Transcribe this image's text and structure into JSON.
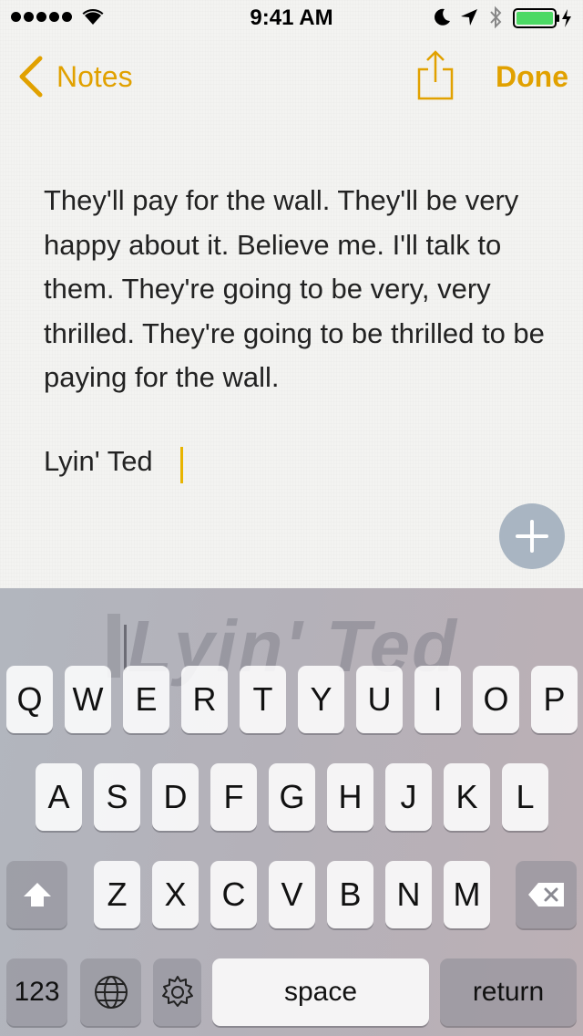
{
  "status_bar": {
    "time": "9:41 AM"
  },
  "nav": {
    "back_label": "Notes",
    "done_label": "Done"
  },
  "note": {
    "body": "They'll pay for the wall. They'll be very happy about it. Believe me. I'll talk to them. They're going to be very, very thrilled. They're going to be thrilled to be paying for the wall.",
    "signature": "Lyin' Ted"
  },
  "keyboard": {
    "prediction_ghost": "Lyin' Ted",
    "row1": [
      "Q",
      "W",
      "E",
      "R",
      "T",
      "Y",
      "U",
      "I",
      "O",
      "P"
    ],
    "row2": [
      "A",
      "S",
      "D",
      "F",
      "G",
      "H",
      "J",
      "K",
      "L"
    ],
    "row3": [
      "Z",
      "X",
      "C",
      "V",
      "B",
      "N",
      "M"
    ],
    "numbers_label": "123",
    "space_label": "space",
    "return_label": "return"
  },
  "colors": {
    "accent": "#e1a100",
    "add_button": "#a9b5c2"
  }
}
